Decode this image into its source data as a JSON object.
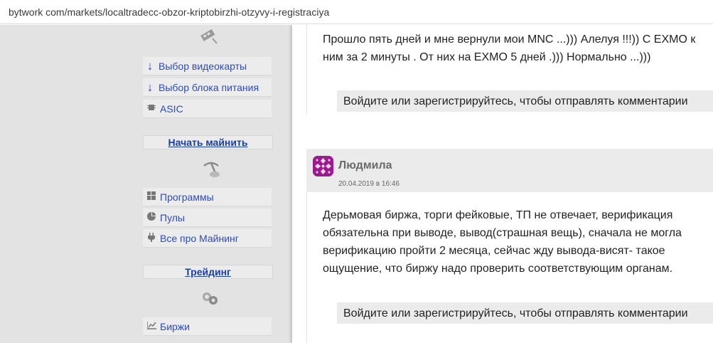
{
  "browser": {
    "url": "bytwork com/markets/localtradecc-obzor-kriptobirzhi-otzyvy-i-registraciya"
  },
  "sidebar": {
    "hardware_items": [
      {
        "label": "Выбор видеокарты",
        "icon": "arrow-down-icon"
      },
      {
        "label": "Выбор блока питания",
        "icon": "arrow-down-icon"
      },
      {
        "label": "ASIC",
        "icon": "chip-icon"
      }
    ],
    "mining_heading": "Начать майнить",
    "mining_items": [
      {
        "label": "Программы",
        "icon": "windows-icon"
      },
      {
        "label": "Пулы",
        "icon": "pie-chart-icon"
      },
      {
        "label": "Все про Майнинг",
        "icon": "plug-icon"
      }
    ],
    "trading_heading": "Трейдинг",
    "trading_items": [
      {
        "label": "Биржи",
        "icon": "line-chart-icon"
      }
    ]
  },
  "comments": [
    {
      "text": "Прошло пять дней и мне вернули мои MNC ...))) Алелуя !!!)) С EXMO к ним за 2 минуты . От них на EXMO 5 дней .))) Нормально ...)))",
      "login_prompt": "Войдите или зарегистрируйтесь, чтобы отправлять комментарии"
    },
    {
      "author": "Людмила",
      "date": "20.04.2019 в 16:46",
      "text": "Дерьмовая биржа, торги фейковые, ТП не отвечает, верификация обязательна при выводе, вывод(страшная вещь), сначала не могла верификацию пройти 2 месяца, сейчас жду вывода-висят- такое ощущение, что биржу надо проверить соответствующим органам.",
      "login_prompt": "Войдите или зарегистрируйтесь, чтобы отправлять комментарии"
    }
  ],
  "colors": {
    "link": "#2b4bbf",
    "heading_link": "#1a3ea8",
    "avatar": "#9b1a8c"
  }
}
